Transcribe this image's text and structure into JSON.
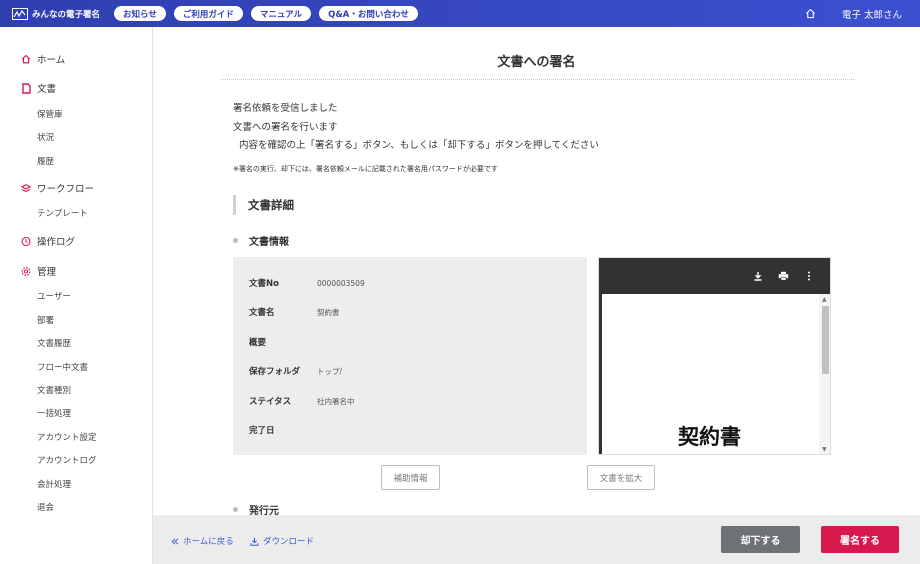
{
  "header": {
    "app_name": "みんなの電子署名",
    "nav": [
      "お知らせ",
      "ご利用ガイド",
      "マニュアル",
      "Q&A・お問い合わせ"
    ],
    "user_name": "電子 太郎さん"
  },
  "sidebar": {
    "home": "ホーム",
    "documents": "文書",
    "documents_sub": [
      "保管庫",
      "状況",
      "履歴"
    ],
    "workflow": "ワークフロー",
    "workflow_sub": [
      "テンプレート"
    ],
    "operation_log": "操作ログ",
    "admin": "管理",
    "admin_sub": [
      "ユーザー",
      "部署",
      "文書履歴",
      "フロー中文書",
      "文書種別",
      "一括処理",
      "アカウント設定",
      "アカウントログ",
      "会計処理",
      "退会"
    ]
  },
  "main": {
    "title": "文書への署名",
    "messages": [
      "署名依頼を受信しました",
      "文書への署名を行います",
      "内容を確認の上「署名する」ボタン、もしくは「却下する」ボタンを押してください"
    ],
    "note": "※署名の実行、却下には、署名依頼メールに記載された署名用パスワードが必要です",
    "section_title": "文書詳細",
    "doc_info_title": "文書情報",
    "fields": [
      {
        "label": "文書No",
        "value": "0000003509"
      },
      {
        "label": "文書名",
        "value": "契約書"
      },
      {
        "label": "概要",
        "value": ""
      },
      {
        "label": "保存フォルダ",
        "value": "トップ/"
      },
      {
        "label": "ステイタス",
        "value": "社内署名中"
      },
      {
        "label": "完了日",
        "value": ""
      }
    ],
    "preview_heading": "契約書",
    "supplement_button": "補助情報",
    "expand_button": "文書を拡大",
    "issuer_title": "発行元"
  },
  "footer": {
    "back_home": "ホームに戻る",
    "download": "ダウンロード",
    "reject": "却下する",
    "sign": "署名する"
  },
  "colors": {
    "header": "#3344c0",
    "sign": "#d7184d",
    "reject": "#6f7275",
    "link": "#3b5bd6"
  }
}
